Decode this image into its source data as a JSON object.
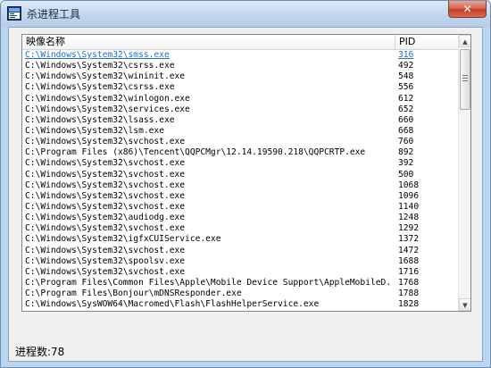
{
  "window": {
    "title": "杀进程工具",
    "close_label": "✕"
  },
  "list": {
    "columns": {
      "name": "映像名称",
      "pid": "PID"
    },
    "rows": [
      {
        "name": "C:\\Windows\\System32\\smss.exe",
        "pid": "316",
        "selected": true
      },
      {
        "name": "C:\\Windows\\System32\\csrss.exe",
        "pid": "492"
      },
      {
        "name": "C:\\Windows\\System32\\wininit.exe",
        "pid": "548"
      },
      {
        "name": "C:\\Windows\\System32\\csrss.exe",
        "pid": "556"
      },
      {
        "name": "C:\\Windows\\System32\\winlogon.exe",
        "pid": "612"
      },
      {
        "name": "C:\\Windows\\System32\\services.exe",
        "pid": "652"
      },
      {
        "name": "C:\\Windows\\System32\\lsass.exe",
        "pid": "660"
      },
      {
        "name": "C:\\Windows\\System32\\lsm.exe",
        "pid": "668"
      },
      {
        "name": "C:\\Windows\\System32\\svchost.exe",
        "pid": "760"
      },
      {
        "name": "C:\\Program Files (x86)\\Tencent\\QQPCMgr\\12.14.19590.218\\QQPCRTP.exe",
        "pid": "892"
      },
      {
        "name": "C:\\Windows\\System32\\svchost.exe",
        "pid": "392"
      },
      {
        "name": "C:\\Windows\\System32\\svchost.exe",
        "pid": "500"
      },
      {
        "name": "C:\\Windows\\System32\\svchost.exe",
        "pid": "1068"
      },
      {
        "name": "C:\\Windows\\System32\\svchost.exe",
        "pid": "1096"
      },
      {
        "name": "C:\\Windows\\System32\\svchost.exe",
        "pid": "1140"
      },
      {
        "name": "C:\\Windows\\System32\\audiodg.exe",
        "pid": "1248"
      },
      {
        "name": "C:\\Windows\\System32\\svchost.exe",
        "pid": "1292"
      },
      {
        "name": "C:\\Windows\\System32\\igfxCUIService.exe",
        "pid": "1372"
      },
      {
        "name": "C:\\Windows\\System32\\svchost.exe",
        "pid": "1472"
      },
      {
        "name": "C:\\Windows\\System32\\spoolsv.exe",
        "pid": "1688"
      },
      {
        "name": "C:\\Windows\\System32\\svchost.exe",
        "pid": "1716"
      },
      {
        "name": "C:\\Program Files\\Common Files\\Apple\\Mobile Device Support\\AppleMobileD...",
        "pid": "1768"
      },
      {
        "name": "C:\\Program Files\\Bonjour\\mDNSResponder.exe",
        "pid": "1788"
      },
      {
        "name": "C:\\Windows\\SysWOW64\\Macromed\\Flash\\FlashHelperService.exe",
        "pid": "1828"
      }
    ]
  },
  "scrollbar": {
    "up_glyph": "▲",
    "down_glyph": "▼"
  },
  "status": {
    "text": "进程数:78"
  },
  "colors": {
    "selected_text": "#1f6fc8",
    "titlebar": "#c4d8ee",
    "close_button": "#c7402a"
  }
}
